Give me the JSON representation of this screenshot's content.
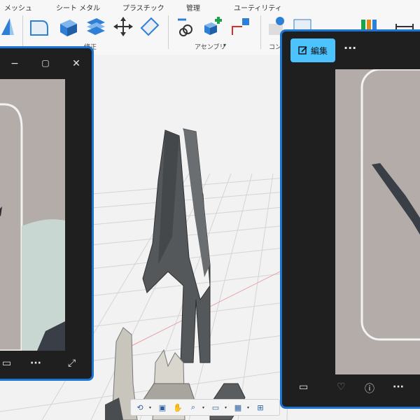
{
  "ribbon": {
    "tabs": [
      "メッシュ",
      "シート メタル",
      "プラスチック",
      "管理",
      "ユーティリティ"
    ],
    "groups": [
      "修正",
      "アセンブリ",
      "コン"
    ],
    "colors": {
      "tool_blue": "#2f7fd6",
      "accent_green": "#1aa34a",
      "accent_red": "#d6302f"
    }
  },
  "left_window": {
    "title_buttons": [
      "−",
      "▢",
      "✕"
    ],
    "toolbar": [
      "▭",
      "···",
      "⤢"
    ]
  },
  "right_window": {
    "edit_label": "編集",
    "more_label": "···",
    "bottom": [
      "▭",
      "♡",
      "ⓘ",
      "···"
    ]
  },
  "navbar": {
    "icons": [
      "orbit-icon",
      "look-at-icon",
      "pan-icon",
      "zoom-icon",
      "fit-icon",
      "display-icon",
      "grid-icon",
      "viewports-icon"
    ]
  }
}
